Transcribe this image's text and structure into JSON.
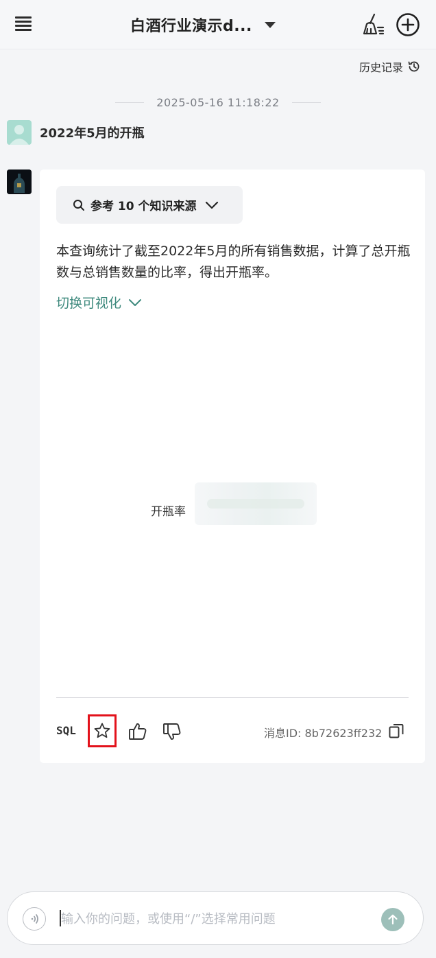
{
  "header": {
    "title": "白酒行业演示d..."
  },
  "history": {
    "label": "历史记录"
  },
  "timestamp": "2025-05-16 11:18:22",
  "user_message": "2022年5月的开瓶",
  "bot": {
    "sources_label": "参考 10 个知识来源",
    "answer": "本查询统计了截至2022年5月的所有销售数据，计算了总开瓶数与总销售数量的比率，得出开瓶率。",
    "viz_toggle": "切换可视化",
    "metric_label": "开瓶率",
    "sql_label": "SQL",
    "message_id": "消息ID: 8b72623ff232"
  },
  "input": {
    "placeholder": "输入你的问题，或使用“/”选择常用问题"
  },
  "colors": {
    "accent": "#3f8a7e",
    "highlight": "#e3121b",
    "send": "#9dbfb9"
  },
  "icons": [
    "menu-icon",
    "caret-down-icon",
    "broom-icon",
    "plus-circle-icon",
    "history-icon",
    "search-icon",
    "chevron-down-icon",
    "star-icon",
    "thumbs-up-icon",
    "thumbs-down-icon",
    "copy-icon",
    "voice-icon",
    "arrow-up-icon"
  ]
}
